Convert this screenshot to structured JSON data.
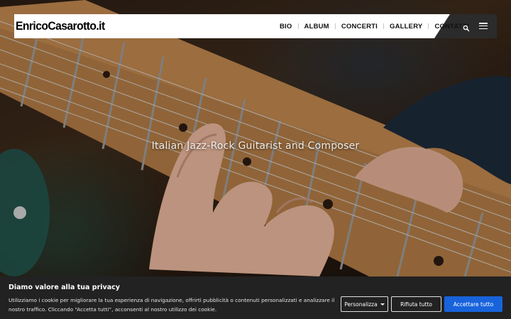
{
  "header": {
    "logo": "EnricoCasarotto.it",
    "nav": [
      "BIO",
      "ALBUM",
      "CONCERTI",
      "GALLERY",
      "CONTATTI"
    ],
    "icons": [
      "search-icon",
      "hamburger-menu-icon"
    ]
  },
  "hero": {
    "tagline": "Italian Jazz-Rock Guitarist and Composer"
  },
  "cookie": {
    "title": "Diamo valore alla tua privacy",
    "text": "Utilizziamo i cookie per migliorare la tua esperienza di navigazione, offrirti pubblicità o contenuti personalizzati e analizzare il nostro traffico. Cliccando “Accetta tutti”, acconsenti al nostro utilizzo dei cookie.",
    "customize": "Personalizza",
    "reject": "Rifiuta tutto",
    "accept": "Accettare tutto"
  },
  "colors": {
    "accept_button": "#1863dc",
    "cookie_bg": "#222222",
    "header_dark": "#2b2b2b"
  }
}
